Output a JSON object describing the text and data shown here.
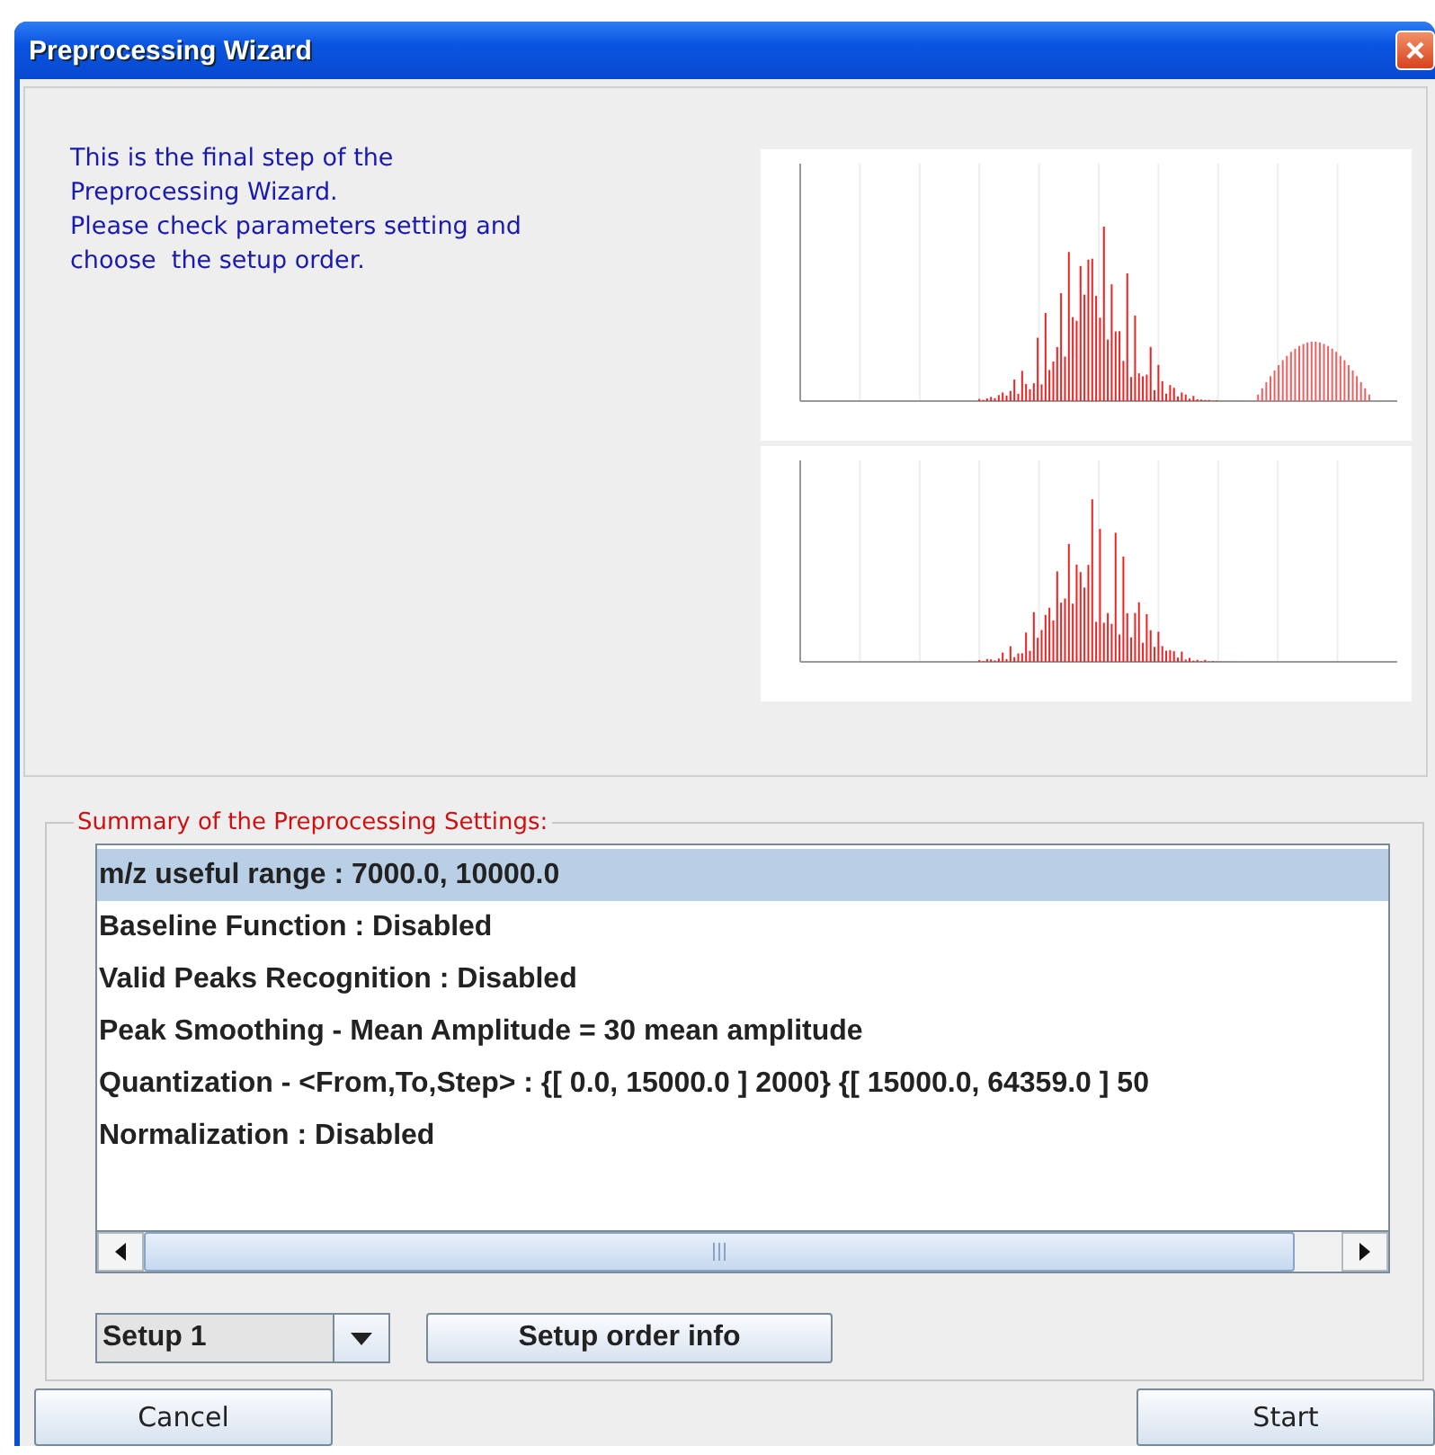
{
  "window": {
    "title": "Preprocessing Wizard"
  },
  "intro": {
    "lines": [
      "This is the final step of the",
      "Preprocessing Wizard.",
      "Please check parameters setting and",
      "choose  the setup order."
    ]
  },
  "summary": {
    "legend": "Summary of the Preprocessing Settings:",
    "items": [
      {
        "text": "m/z useful range : 7000.0, 10000.0",
        "selected": true
      },
      {
        "text": "Baseline Function : Disabled",
        "selected": false
      },
      {
        "text": "Valid Peaks Recognition : Disabled",
        "selected": false
      },
      {
        "text": "Peak Smoothing - Mean Amplitude = 30 mean amplitude",
        "selected": false
      },
      {
        "text": "Quantization - <From,To,Step> : {[ 0.0, 15000.0 ] 2000} {[ 15000.0, 64359.0 ] 50",
        "selected": false
      },
      {
        "text": "Normalization : Disabled",
        "selected": false
      }
    ]
  },
  "setup_select": {
    "value": "Setup 1"
  },
  "setup_info_button": "Setup order info",
  "buttons": [
    {
      "label": "Cancel"
    },
    {
      "label": "Start"
    }
  ]
}
